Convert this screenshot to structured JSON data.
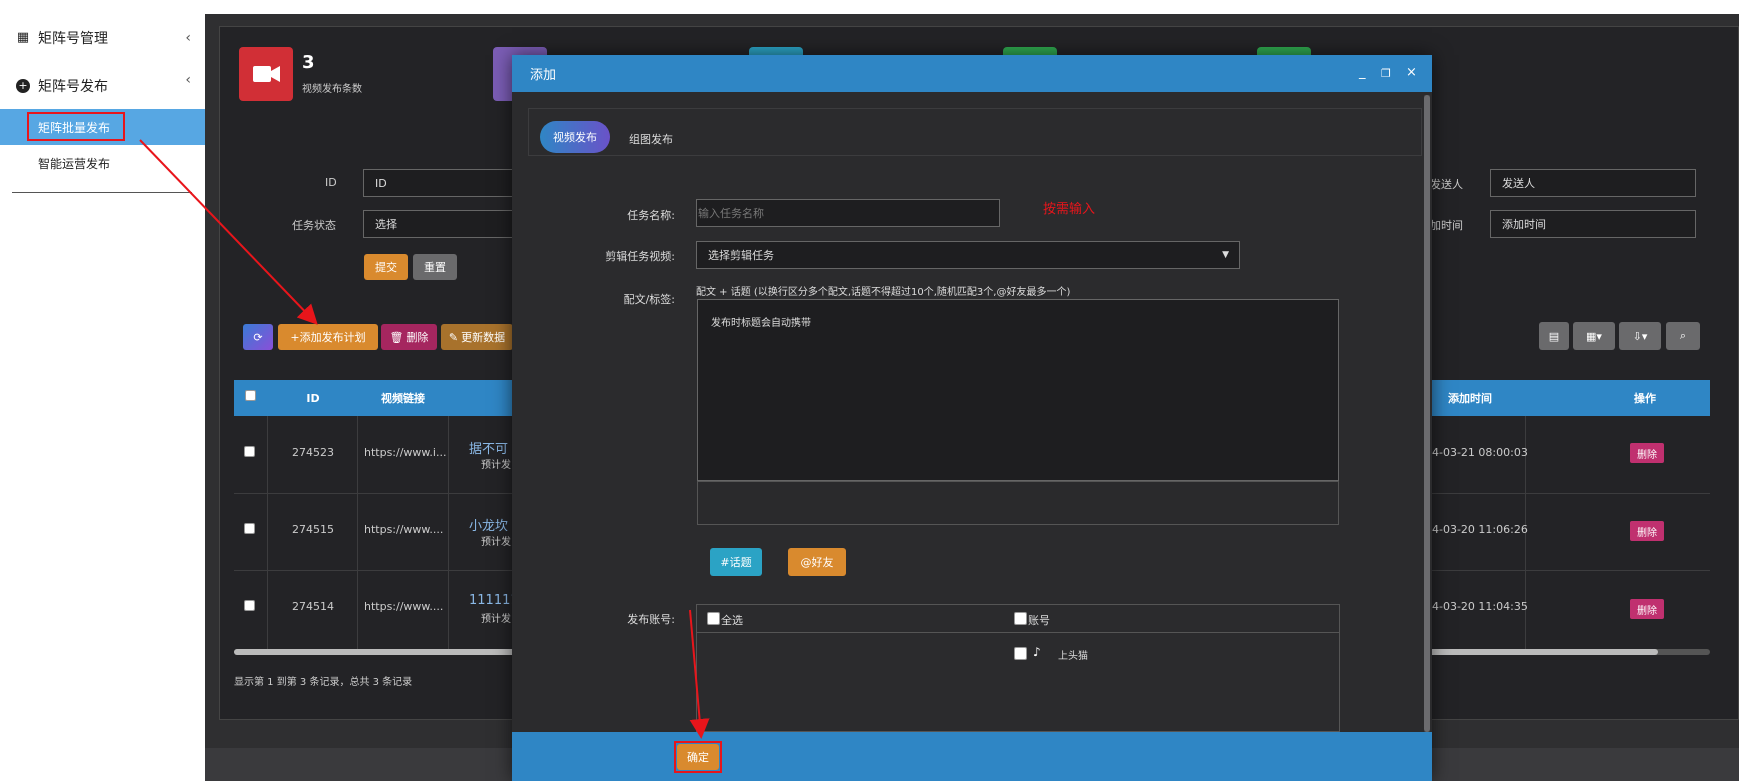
{
  "sidebar": {
    "items": [
      {
        "label": "矩阵号管理",
        "icon": "grid-icon"
      },
      {
        "label": "矩阵号发布",
        "icon": "plus-circle-icon"
      }
    ],
    "sub_items": [
      {
        "label": "矩阵批量发布",
        "active": true
      },
      {
        "label": "智能运营发布",
        "active": false
      }
    ]
  },
  "stats": {
    "count": "3",
    "label": "视频发布条数"
  },
  "filters": {
    "id_label": "ID",
    "id_placeholder": "ID",
    "status_label": "任务状态",
    "status_value": "选择",
    "sender_label": "发送人",
    "sender_placeholder": "发送人",
    "addtime_label": "加时间",
    "addtime_placeholder": "添加时间",
    "submit": "提交",
    "reset": "重置"
  },
  "toolbar": {
    "refresh": "",
    "add_plan": "+添加发布计划",
    "delete": "删除",
    "update": "更新数据"
  },
  "table": {
    "headers": [
      "ID",
      "视频链接",
      "添加时间",
      "操作"
    ],
    "rows": [
      {
        "id": "274523",
        "link": "https://www.i...",
        "title": "据不可",
        "sub": "预计发",
        "time": "4-03-21 08:00:03",
        "op": "删除"
      },
      {
        "id": "274515",
        "link": "https://www....",
        "title": "小龙坎",
        "sub": "预计发",
        "time": "4-03-20 11:06:26",
        "op": "删除"
      },
      {
        "id": "274514",
        "link": "https://www....",
        "title": "111111",
        "sub": "预计发",
        "time": "4-03-20 11:04:35",
        "op": "删除"
      }
    ],
    "footer": "显示第 1 到第 3 条记录，总共 3 条记录"
  },
  "modal": {
    "title": "添加",
    "tabs": [
      "视频发布",
      "组图发布"
    ],
    "task_name_label": "任务名称:",
    "task_name_placeholder": "输入任务名称",
    "task_name_hint": "按需输入",
    "edit_video_label": "剪辑任务视频:",
    "edit_video_value": "选择剪辑任务",
    "caption_label": "配文/标签:",
    "caption_desc": "配文 + 话题  (以换行区分多个配文,话题不得超过10个,随机匹配3个,@好友最多一个)",
    "caption_text": "发布时标题会自动携带",
    "topic_btn": "#话题",
    "friend_btn": "@好友",
    "account_label": "发布账号:",
    "select_all": "全选",
    "account_col": "账号",
    "account_name": "上头猫",
    "confirm": "确定"
  },
  "colors": {
    "accent_blue": "#2f86c5",
    "orange": "#d98a2e",
    "red_annotation": "#e8151b",
    "delete_pink": "#c0306f"
  }
}
